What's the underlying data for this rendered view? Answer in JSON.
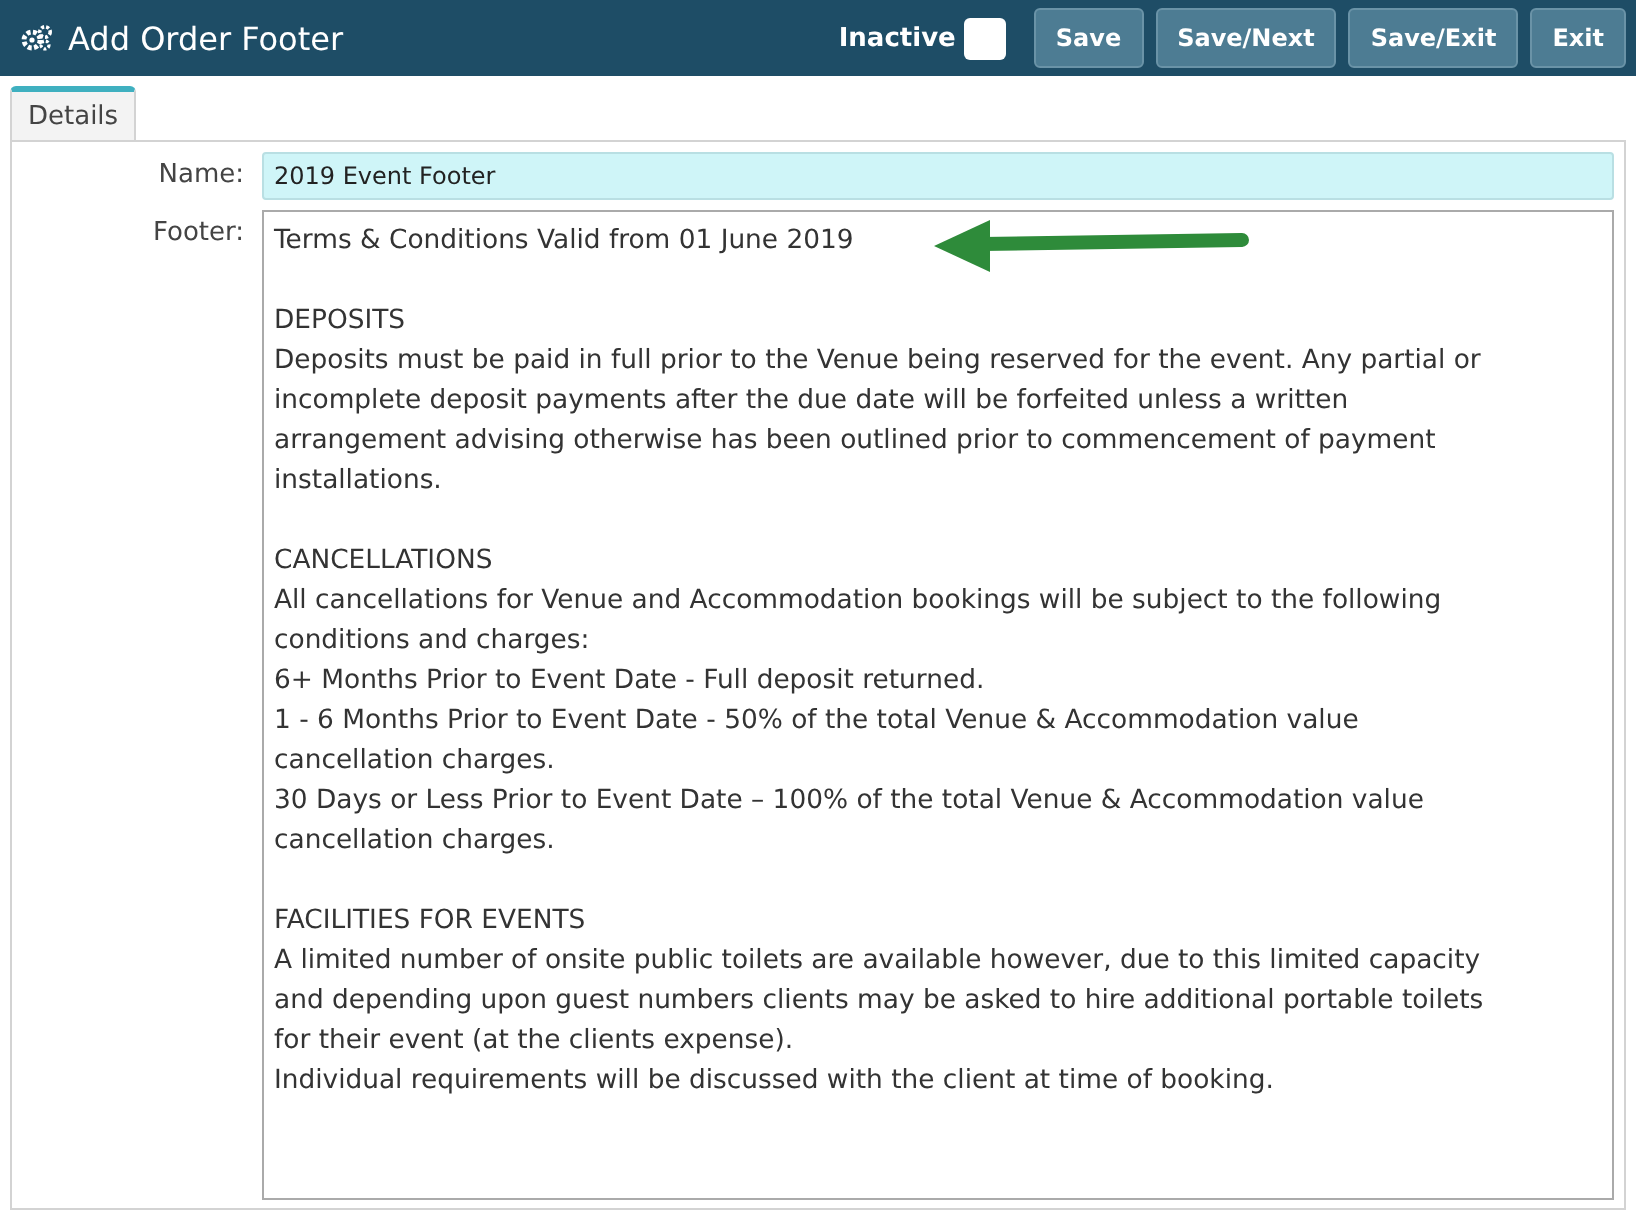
{
  "window": {
    "title": "Add Order Footer"
  },
  "inactive": {
    "label": "Inactive",
    "checked": false
  },
  "buttons": [
    "Save",
    "Save/Next",
    "Save/Exit",
    "Exit"
  ],
  "tabs": [
    {
      "label": "Details",
      "selected": true
    }
  ],
  "name": {
    "label": "Name:",
    "value": "2019 Event Footer"
  },
  "footer": {
    "label": "Footer:",
    "paragraphs": [
      [
        "Terms & Conditions Valid from 01 June 2019"
      ],
      [
        "DEPOSITS",
        "Deposits must be paid in full prior to the Venue being reserved for the event. Any partial or",
        "incomplete deposit payments after the due date will be forfeited unless a written",
        "arrangement advising otherwise has been outlined prior to commencement of payment",
        "installations."
      ],
      [
        "CANCELLATIONS",
        "All cancellations for Venue and Accommodation bookings will be subject to the following",
        "conditions and charges:",
        "6+ Months Prior to Event Date - Full deposit returned.",
        "1 - 6 Months Prior to Event Date  - 50% of the total Venue & Accommodation value",
        "cancellation charges.",
        "30 Days or Less Prior to Event Date – 100% of the total Venue & Accommodation value",
        "cancellation charges."
      ],
      [
        "FACILITIES FOR EVENTS",
        "A limited number of onsite public toilets are available however, due to this limited capacity",
        "and depending upon guest numbers clients may be asked to hire additional portable toilets",
        "for their event (at the clients expense).",
        "Individual requirements will be discussed with the client at time of booking."
      ]
    ]
  }
}
